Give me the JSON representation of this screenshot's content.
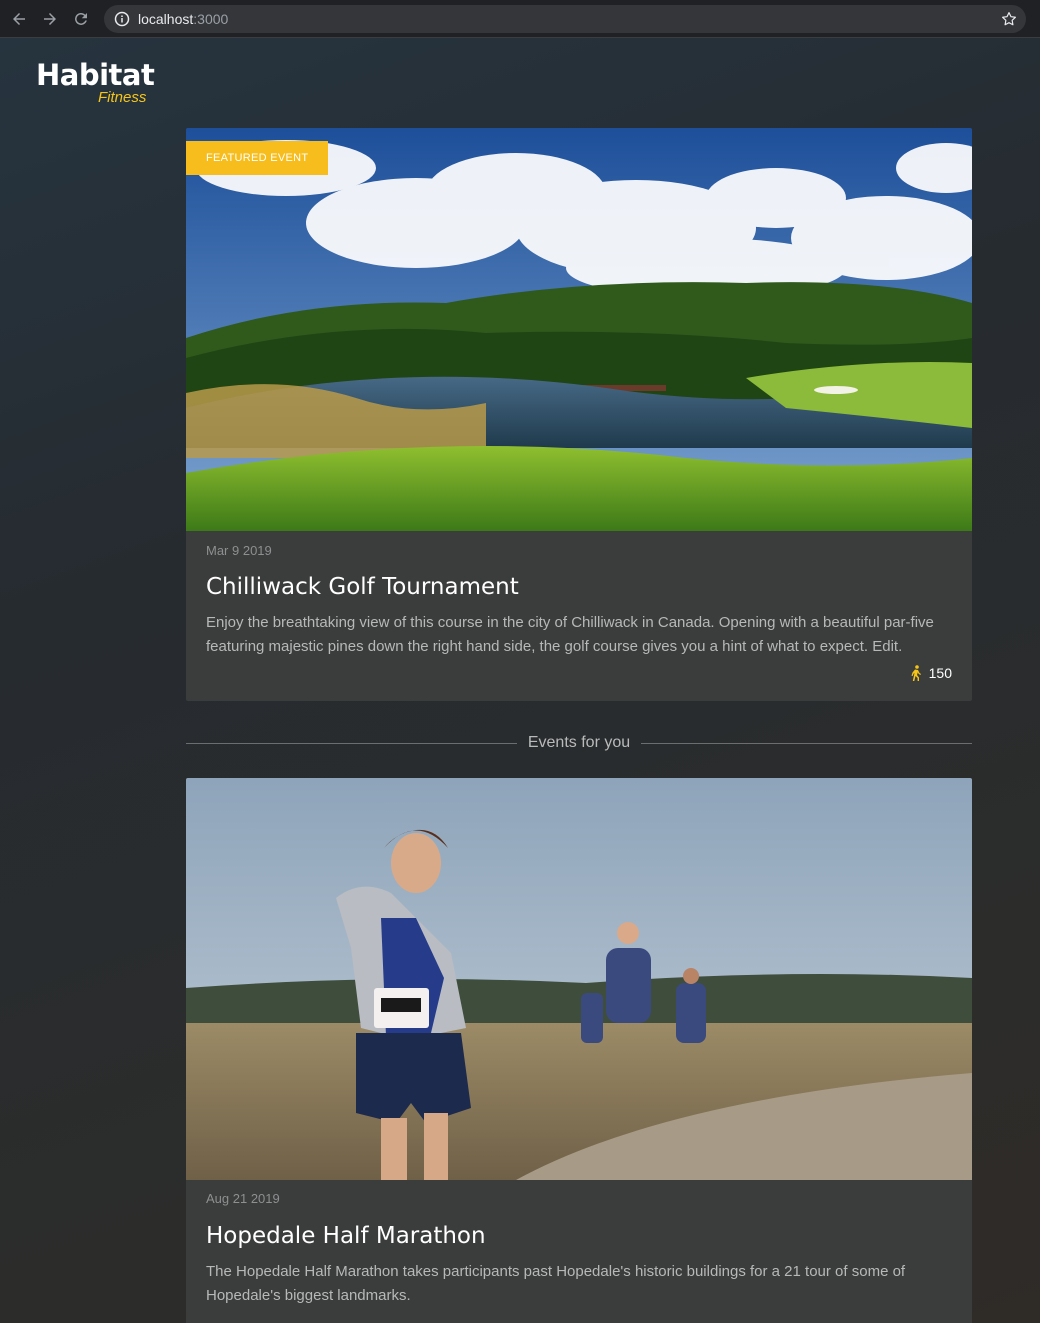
{
  "browser": {
    "url_host": "localhost",
    "url_port": ":3000"
  },
  "logo": {
    "main": "Habitat",
    "sub": "Fitness",
    "accent_color": "#f5c518"
  },
  "featured": {
    "badge": "FEATURED EVENT",
    "attendees": "150",
    "date": "Mar 9 2019",
    "title": "Chilliwack Golf Tournament",
    "description": "Enjoy the breathtaking view of this course in the city of Chilliwack in Canada. Opening with a beautiful par-five featuring majestic pines down the right hand side, the golf course gives you a hint of what to expect. Edit."
  },
  "section": {
    "label": "Events for you"
  },
  "events": [
    {
      "date": "Aug 21 2019",
      "title": "Hopedale Half Marathon",
      "description": "The Hopedale Half Marathon takes participants past Hopedale's historic buildings for a 21 tour of some of Hopedale's biggest landmarks."
    }
  ],
  "icons": {
    "back": "arrow-left-icon",
    "forward": "arrow-right-icon",
    "reload": "reload-icon",
    "info": "info-icon",
    "bookmark": "star-icon",
    "attendees": "walking-person-icon"
  }
}
